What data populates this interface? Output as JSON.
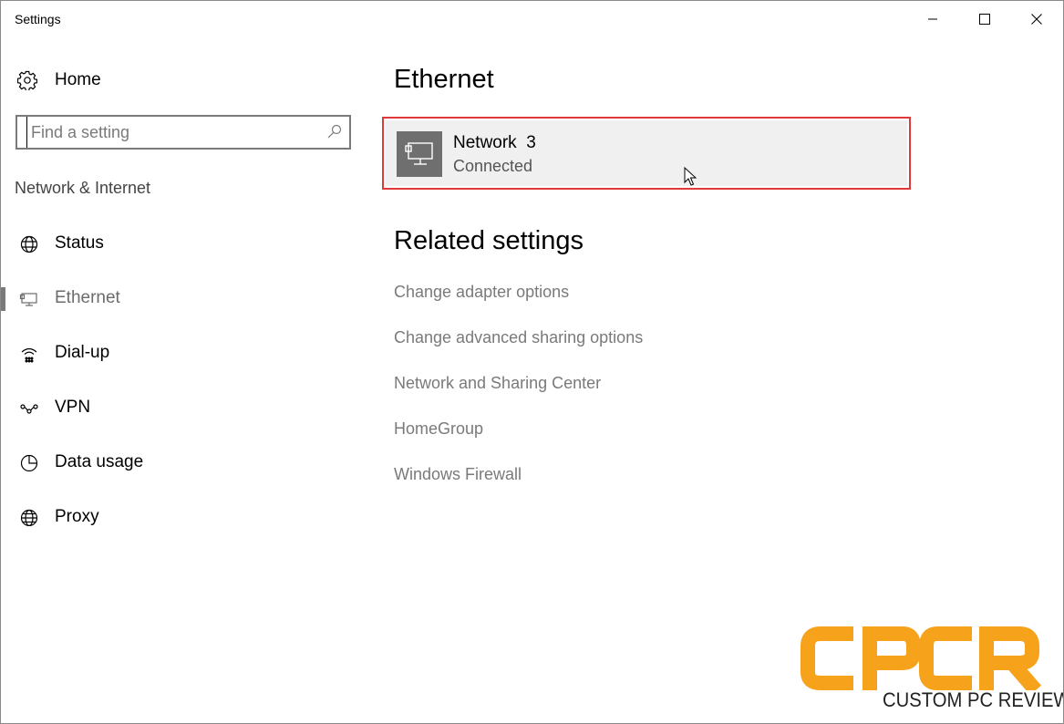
{
  "window": {
    "title": "Settings",
    "controls": [
      "minimize",
      "maximize",
      "close"
    ]
  },
  "sidebar": {
    "home_label": "Home",
    "search": {
      "placeholder": "Find a setting",
      "value": ""
    },
    "section_label": "Network & Internet",
    "items": [
      {
        "label": "Status",
        "icon": "globe-status-icon",
        "active": false
      },
      {
        "label": "Ethernet",
        "icon": "ethernet-icon",
        "active": true
      },
      {
        "label": "Dial-up",
        "icon": "dial-up-icon",
        "active": false
      },
      {
        "label": "VPN",
        "icon": "vpn-icon",
        "active": false
      },
      {
        "label": "Data usage",
        "icon": "data-usage-icon",
        "active": false
      },
      {
        "label": "Proxy",
        "icon": "globe-icon",
        "active": false
      }
    ]
  },
  "main": {
    "heading": "Ethernet",
    "network": {
      "name": "Network  3",
      "status": "Connected",
      "icon": "network-adapter-icon"
    },
    "related_heading": "Related settings",
    "related_links": [
      "Change adapter options",
      "Change advanced sharing options",
      "Network and Sharing Center",
      "HomeGroup",
      "Windows Firewall"
    ]
  },
  "watermark": {
    "logo_text": "CPCR",
    "tagline": "CUSTOM PC REVIEW",
    "color": "#f7a21b"
  },
  "colors": {
    "highlight_border": "#e0393c",
    "link": "#7a7a7a",
    "icon_tile": "#6f6f6f"
  }
}
